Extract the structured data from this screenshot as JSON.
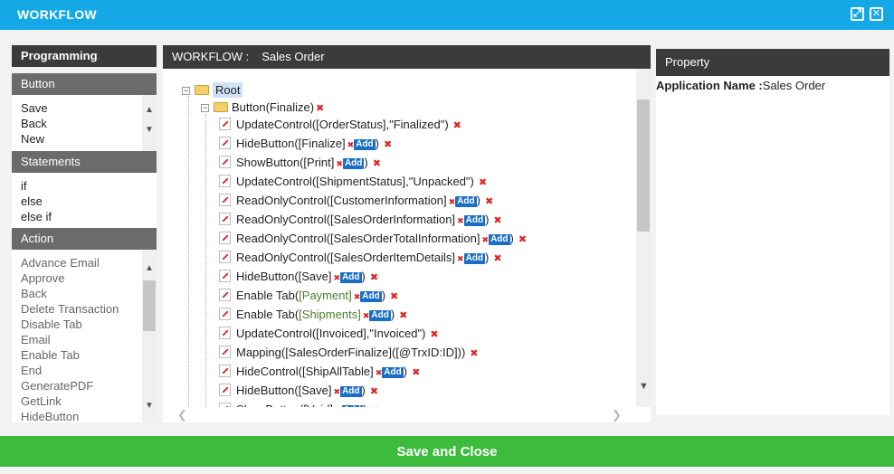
{
  "window": {
    "title": "WORKFLOW",
    "maximize_icon": "⤢",
    "close_icon": "✕"
  },
  "programming": {
    "header": "Programming",
    "button": {
      "header": "Button",
      "items": [
        "Save",
        "Back",
        "New"
      ]
    },
    "statements": {
      "header": "Statements",
      "items": [
        "if",
        "else",
        "else if"
      ]
    },
    "action": {
      "header": "Action",
      "items": [
        "Advance Email",
        "Approve",
        "Back",
        "Delete Transaction",
        "Disable Tab",
        "Email",
        "Enable Tab",
        "End",
        "GeneratePDF",
        "GetLink",
        "HideButton"
      ]
    }
  },
  "workflow": {
    "label": "WORKFLOW :",
    "name": "Sales Order",
    "tree": {
      "root": "Root",
      "branch": "Button(Finalize)",
      "add_label": "Add",
      "nodes": [
        {
          "a": "UpdateControl([OrderStatus],\"Finalized\")",
          "add": false
        },
        {
          "a": "HideButton([Finalize]",
          "add": true,
          "b": ")"
        },
        {
          "a": "ShowButton([Print]",
          "add": true,
          "b": ")"
        },
        {
          "a": "UpdateControl([ShipmentStatus],\"Unpacked\")",
          "add": false
        },
        {
          "a": "ReadOnlyControl([CustomerInformation]",
          "add": true,
          "b": ")"
        },
        {
          "a": "ReadOnlyControl([SalesOrderInformation]",
          "add": true,
          "b": ")"
        },
        {
          "a": "ReadOnlyControl([SalesOrderTotalInformation]",
          "add": true,
          "b": ")"
        },
        {
          "a": "ReadOnlyControl([SalesOrderItemDetails]",
          "add": true,
          "b": ")"
        },
        {
          "a": "HideButton([Save]",
          "add": true,
          "b": ")"
        },
        {
          "a": "Enable Tab(",
          "g": "[Payment]",
          "add": true,
          "b": ")"
        },
        {
          "a": "Enable Tab(",
          "g": "[Shipments]",
          "add": true,
          "b": ")"
        },
        {
          "a": "UpdateControl([Invoiced],\"Invoiced\")",
          "add": false
        },
        {
          "a": "Mapping([SalesOrderFinalize]([@TrxID:ID]))",
          "add": false
        },
        {
          "a": "HideControl([ShipAllTable]",
          "add": true,
          "b": ")"
        },
        {
          "a": "HideButton([Save]",
          "add": true,
          "b": ")"
        },
        {
          "a": "ShowButton([Void]",
          "add": true,
          "b": ")"
        }
      ]
    }
  },
  "property": {
    "header": "Property",
    "app_name_label": "Application Name :",
    "app_name_value": "Sales Order"
  },
  "footer": {
    "save_label": "Save and Close"
  },
  "colors": {
    "titlebar": "#15a8e6",
    "panel_dark": "#3b3b3b",
    "panel_grey": "#6b6b6b",
    "save_green": "#3dbb3d",
    "remove_red": "#e02424",
    "add_blue": "#1a6fc4"
  }
}
